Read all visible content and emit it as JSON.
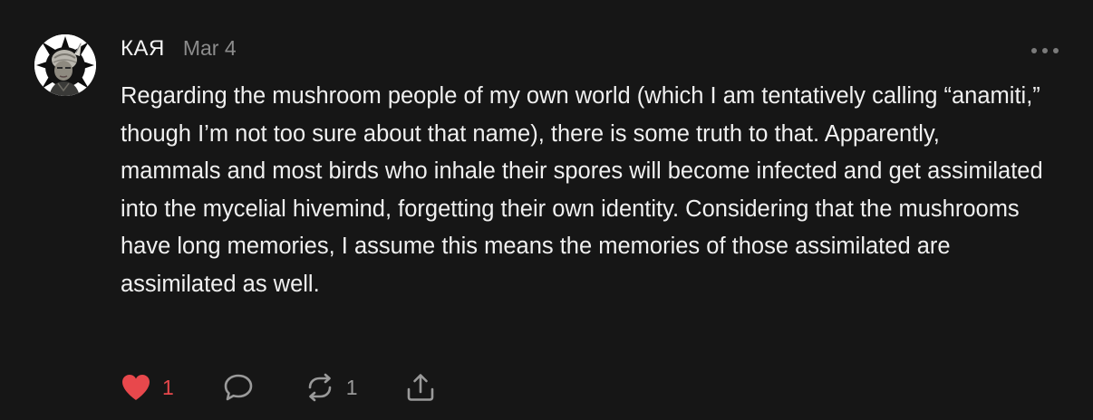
{
  "comment": {
    "author": "КАЯ",
    "date": "Mar 4",
    "body": "Regarding the mushroom people of my own world (which I am tentatively calling “anamiti,” though I’m not too sure about that name), there is some truth to that. Apparently, mammals and most birds who inhale their spores will become infected and get assimilated into the mycelial hivemind, forgetting their own identity. Considering that the mushrooms have long memories, I assume this means the memories of those assimilated are assimilated as well.",
    "likes": "1",
    "restacks": "1"
  },
  "icons": {
    "avatar": "avatar",
    "more": "more-icon",
    "like": "heart-icon",
    "reply": "reply-bubble-icon",
    "restack": "restack-icon",
    "share": "share-icon"
  },
  "colors": {
    "background": "#161616",
    "text": "#f0f0f0",
    "muted": "#8c8c8c",
    "like": "#e8484c"
  }
}
